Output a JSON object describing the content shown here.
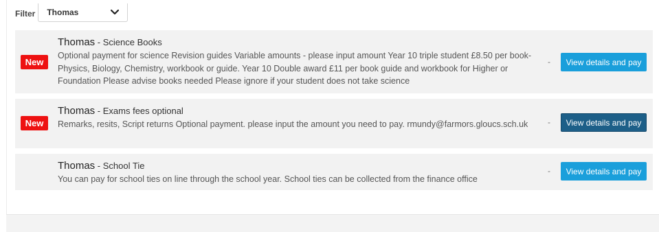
{
  "filter": {
    "label": "Filter",
    "selected": "Thomas"
  },
  "payments": [
    {
      "payee": "Thomas",
      "separator": " - ",
      "name": "Science Books",
      "badge": "New",
      "description": "Optional payment for science Revision guides Variable amounts - please input amount Year 10 triple student £8.50 per book- Physics, Biology, Chemistry, workbook or guide. Year 10 Double award £11 per book guide and workbook for Higher or Foundation Please advise books needed Please ignore if your student does not take science",
      "amount": "-",
      "button_label": "View details and pay"
    },
    {
      "payee": "Thomas",
      "separator": " - ",
      "name": "Exams fees optional",
      "badge": "New",
      "description": "Remarks, resits, Script returns Optional payment. please input the amount you need to pay. rmundy@farmors.gloucs.sch.uk",
      "amount": "-",
      "button_label": "View details and pay"
    },
    {
      "payee": "Thomas",
      "separator": " - ",
      "name": "School Tie",
      "description": "You can pay for school ties on line through the school year. School ties can be collected from the finance office",
      "amount": "-",
      "button_label": "View details and pay"
    }
  ],
  "colors": {
    "new_badge": "#ee1111",
    "button": "#1a9fdb",
    "button_active": "#1d5f88",
    "row_background": "#f2f2f2"
  }
}
